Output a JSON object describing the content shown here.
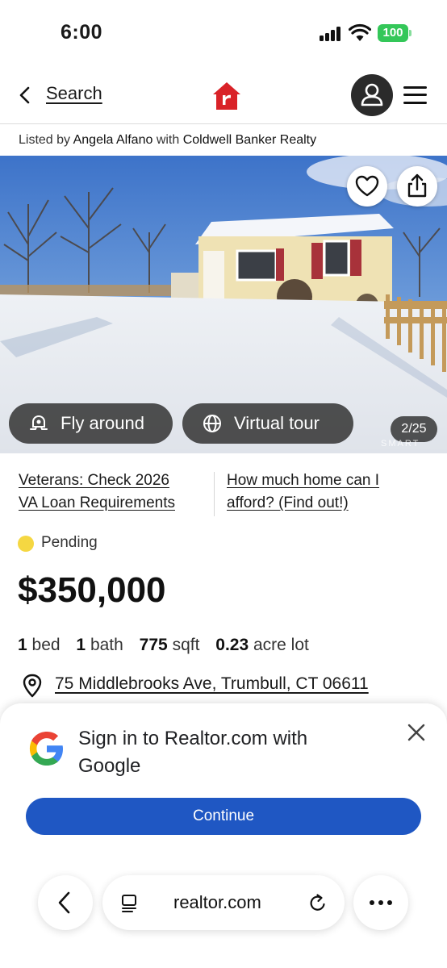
{
  "status_bar": {
    "time": "6:00",
    "battery": "100"
  },
  "header": {
    "back_label": "Search"
  },
  "listing": {
    "listed_by_prefix": "Listed by",
    "agent": "Angela Alfano",
    "with": "with",
    "brokerage": "Coldwell Banker Realty"
  },
  "photo": {
    "fly_around_label": "Fly around",
    "virtual_tour_label": "Virtual tour",
    "counter": "2/25",
    "watermark": "SMART"
  },
  "promos": {
    "left_line1": "Veterans: Check 2026",
    "left_line2": "VA Loan Requirements",
    "right_line1": "How much home can I",
    "right_line2": "afford? (Find out!)"
  },
  "property": {
    "status": "Pending",
    "price": "$350,000",
    "beds_value": "1",
    "beds_unit": "bed",
    "baths_value": "1",
    "baths_unit": "bath",
    "sqft_value": "775",
    "sqft_unit": "sqft",
    "lot_value": "0.23",
    "lot_unit": "acre lot",
    "address": "75 Middlebrooks Ave, Trumbull, CT 06611"
  },
  "google_sheet": {
    "title": "Sign in to Realtor.com with Google",
    "continue_label": "Continue"
  },
  "browser": {
    "url": "realtor.com"
  },
  "colors": {
    "brand_red": "#d92228",
    "status_pending": "#f5d742",
    "google_button": "#1f57c3",
    "battery_green": "#34c759"
  }
}
